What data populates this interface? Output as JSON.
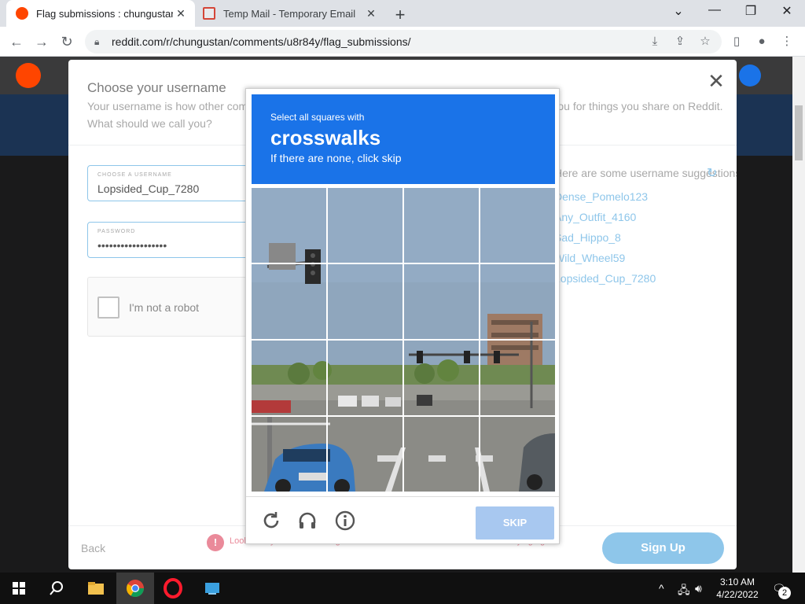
{
  "browser": {
    "tabs": [
      {
        "title": "Flag submissions : chungustan",
        "active": true
      },
      {
        "title": "Temp Mail - Temporary Email",
        "active": false
      }
    ],
    "url": "reddit.com/r/chungustan/comments/u8r84y/flag_submissions/"
  },
  "modal": {
    "title": "Choose your username",
    "description": "Your username is how other community members will see you. This name will be used to credit you for things you share on Reddit. What should we call you?",
    "username_label": "CHOOSE A USERNAME",
    "username_value": "Lopsided_Cup_7280",
    "password_label": "PASSWORD",
    "password_value": "••••••••••••••••••",
    "recaptcha_label": "I'm not a robot",
    "suggestions_title": "Here are some username suggestions",
    "suggestions": [
      "Dense_Pomelo123",
      "Any_Outfit_4160",
      "Sad_Hippo_8",
      "Wild_Wheel59",
      "Lopsided_Cup_7280"
    ],
    "back_label": "Back",
    "error_icon": "!",
    "error_message": "Looks like you've been doing that a lot. Take a break for 6 minutes before trying again.",
    "signup_label": "Sign Up"
  },
  "captcha": {
    "line1": "Select all squares with",
    "target": "crosswalks",
    "line3": "If there are none, click skip",
    "skip_label": "SKIP",
    "icons": [
      "reload-icon",
      "audio-icon",
      "info-icon"
    ]
  },
  "taskbar": {
    "time": "3:10 AM",
    "date": "4/22/2022",
    "notification_count": "2"
  },
  "colors": {
    "captcha_blue": "#1a73e8",
    "reddit_orange": "#ff4500",
    "signup_blue": "#8ec6ea",
    "error_pink": "#ea8a9a"
  }
}
